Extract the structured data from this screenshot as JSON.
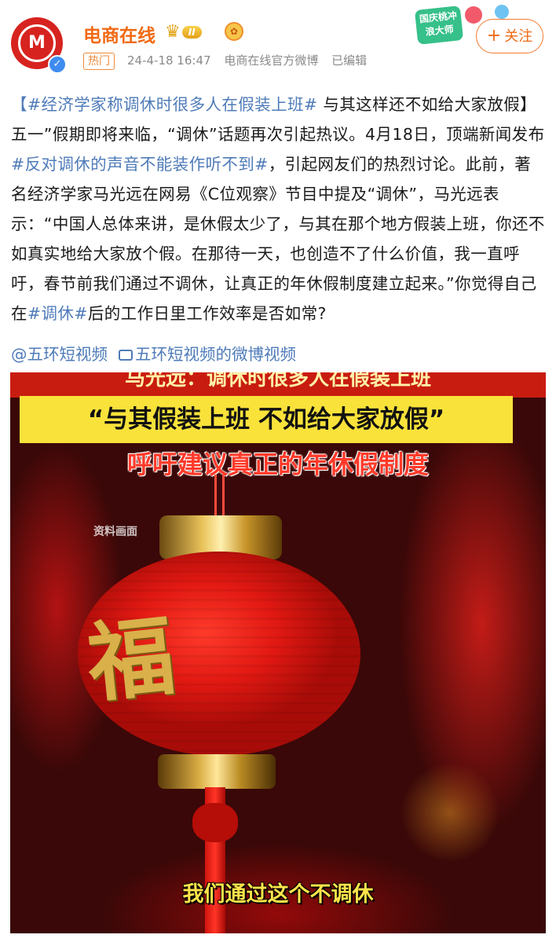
{
  "header": {
    "username": "电商在线",
    "level_badge": "II",
    "hot_tag": "热门",
    "timestamp": "24-4-18 16:47",
    "source": "电商在线官方微博",
    "edited": "已编辑",
    "follow_label": "关注",
    "promo_badge": "国庆桃冲浪大师"
  },
  "post": {
    "seg1_link": "【#经济学家称调休时很多人在假装上班#",
    "seg2": " 与其这样还不如给大家放假】五一”假期即将来临，“调休”话题再次引起热议。4月18日，顶端新闻发布",
    "seg3_link": "#反对调休的声音不能装作听不到#",
    "seg4": "，引起网友们的热烈讨论。此前，著名经济学家马光远在网易《C位观察》节目中提及“调休”，马光远表示：“中国人总体来讲，是休假太少了，与其在那个地方假装上班，你还不如真实地给大家放个假。在那待一天，也创造不了什么价值，我一直呼吁，春节前我们通过不调休，让真正的年休假制度建立起来。”你觉得自己在",
    "seg5_link": "#调休#",
    "seg6": "后的工作日里工作效率是否如常?",
    "mention": "@五环短视频",
    "video_link": "五环短视频的微博视频"
  },
  "media": {
    "caption_top": "马光远：调休时很多人在假装上班",
    "caption_yellow": "“与其假装上班 不如给大家放假”",
    "caption_red": "呼吁建议真正的年休假制度",
    "source_label": "资料画面",
    "lantern_char": "福",
    "subtitle": "我们通过这个不调休"
  },
  "colors": {
    "brand_orange": "#f16a14",
    "link_blue": "#4e7bb8",
    "caption_yellow": "#f9e23a",
    "lantern_red": "#e01812"
  }
}
